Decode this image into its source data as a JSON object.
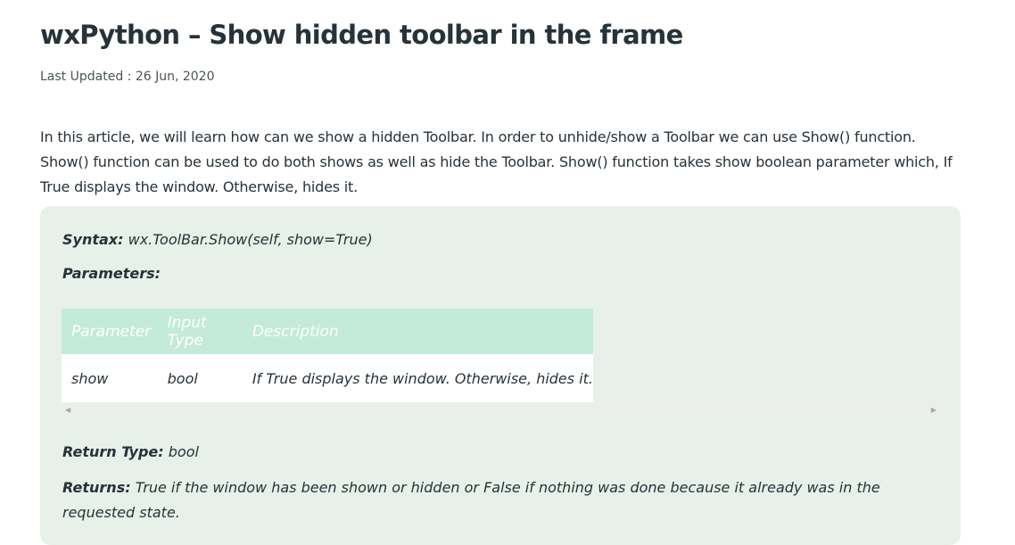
{
  "article": {
    "title": "wxPython – Show hidden toolbar in the frame",
    "last_updated": "Last Updated : 26 Jun, 2020",
    "intro": "In this article, we will learn how can we show a hidden Toolbar. In order to unhide/show a Toolbar we can use Show() function. Show() function can be used to do both shows as well as hide the Toolbar. Show() function takes show boolean parameter which, If True displays the window. Otherwise, hides it."
  },
  "syntax": {
    "label": "Syntax:",
    "value": "wx.ToolBar.Show(self, show=True)"
  },
  "parameters": {
    "label": "Parameters:",
    "columns": [
      "Parameter",
      "Input Type",
      "Description"
    ],
    "rows": [
      [
        "show",
        "bool",
        "If True displays the window. Otherwise, hides it."
      ]
    ]
  },
  "return_type": {
    "label": "Return Type:",
    "value": "bool"
  },
  "returns": {
    "label": "Returns:",
    "value": "True if the window has been shown or hidden or False if nothing was done because it already was in the requested state."
  },
  "icons": {
    "scroll_left": "scroll-left-arrow-icon",
    "scroll_right": "scroll-right-arrow-icon"
  },
  "colors": {
    "text": "#273239",
    "box_background": "#e7f1e9",
    "table_header": "#c4eada"
  }
}
